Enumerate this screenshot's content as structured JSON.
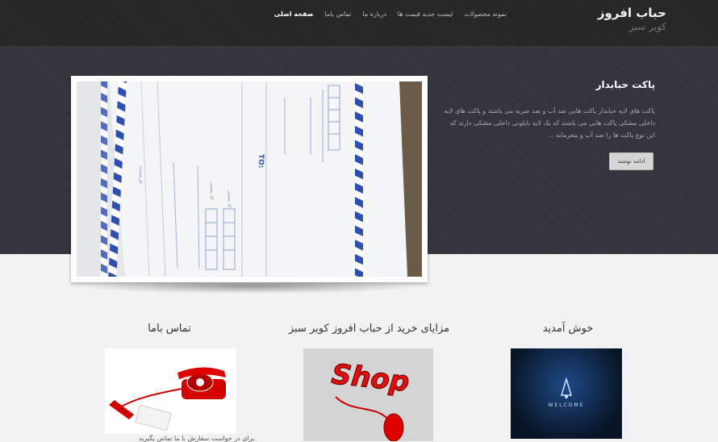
{
  "brand": {
    "title": "حباب افروز",
    "subtitle": "کویر سبز"
  },
  "nav": {
    "items": [
      {
        "label": "صفحه اصلی"
      },
      {
        "label": "تماس باما"
      },
      {
        "label": "درباره ما"
      },
      {
        "label": "لیست جدید قیمت ها"
      },
      {
        "label": "نمونه محصولات"
      }
    ]
  },
  "hero": {
    "title": "پاکت حبابدار",
    "body": "پاکت های لایه حبابدار پاکت هایی ضد آب و ضد ضربه می باشند و پاکت های لایه داخلی مشکی پاکت هایی می باشند که یک لایه نایلونی داخلی مشکی دارند که این نوع پاکت ها را ضد آب و محرمانه ...",
    "button": "ادامه نوشته",
    "photo_text": {
      "to": "TO:",
      "sender": "فرستنده",
      "zip1": "کد پستی",
      "zip2": "کد پستی"
    }
  },
  "sections": {
    "welcome": {
      "title": "خوش آمدید",
      "image_text": "WELCOME"
    },
    "advantages": {
      "title": "مزایای خرید از حباب افروز کویر سبز",
      "image_text": "Shop"
    },
    "contact": {
      "title": "تماس باما",
      "caption": "برای در خواست سفارش با ما تماس بگیرید"
    }
  },
  "colors": {
    "topbar": "#2a2a2a",
    "hero": "#34383e",
    "page": "#f2f2f2",
    "envelope_stripe": "#2f4fb0"
  }
}
